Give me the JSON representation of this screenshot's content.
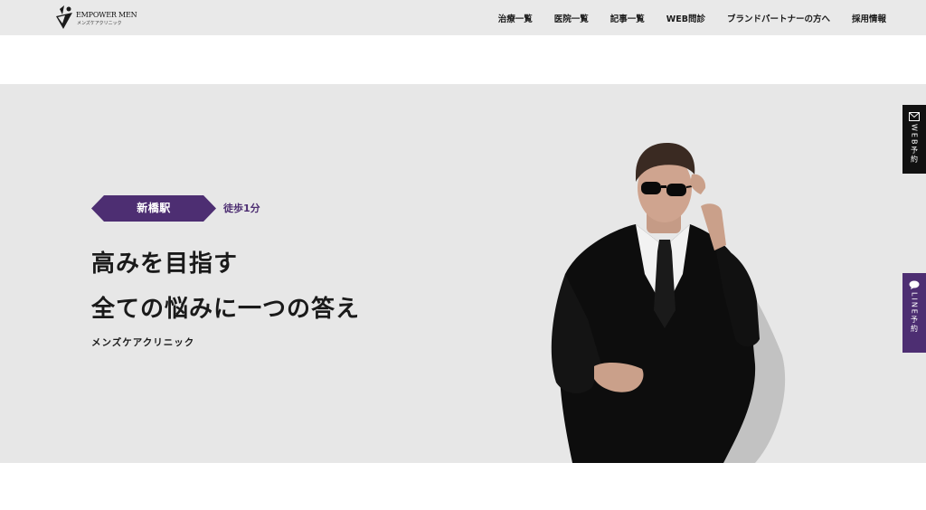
{
  "header": {
    "logo_title": "EMPOWER MEN",
    "logo_subtitle": "メンズケアクリニック",
    "nav": [
      {
        "label": "治療一覧"
      },
      {
        "label": "医院一覧"
      },
      {
        "label": "記事一覧"
      },
      {
        "label": "WEB問診"
      },
      {
        "label": "ブランドパートナーの方へ"
      },
      {
        "label": "採用情報"
      }
    ]
  },
  "hero": {
    "station_badge": "新橋駅",
    "walk_time": "徒歩1分",
    "headline_line1": "高みを目指す",
    "headline_line2": "全ての悩みに一つの答え",
    "subtext": "メンズケアクリニック"
  },
  "side_tabs": {
    "web": {
      "label": "WEB予約",
      "icon": "mail-icon"
    },
    "line": {
      "label": "LINE予約",
      "icon": "chat-bubble-icon"
    }
  },
  "colors": {
    "header_bg": "#e9e9e9",
    "hero_bg": "#e7e7e7",
    "accent_purple": "#4d2e72",
    "web_tab_bg": "#111111",
    "text_dark": "#1a1a1a"
  }
}
